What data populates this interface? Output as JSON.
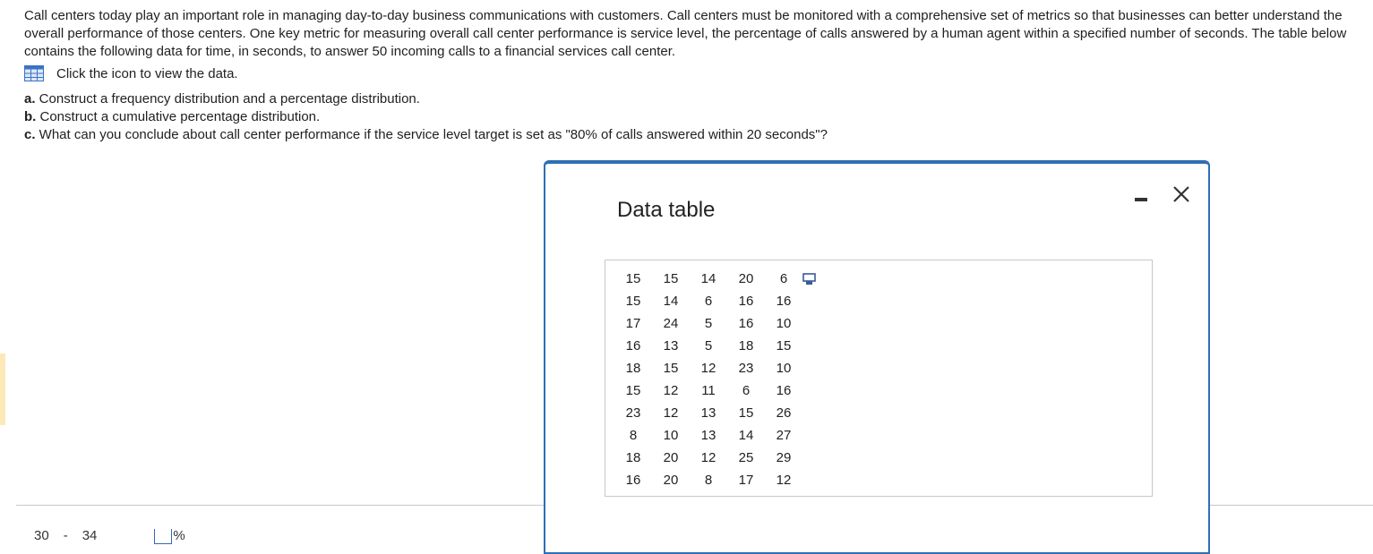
{
  "problem": {
    "intro": "Call centers today play an important role in managing day-to-day business communications with customers. Call centers must be monitored with a comprehensive set of metrics so that businesses can better understand the overall performance of those centers. One key metric for measuring overall call center performance is service level, the percentage of calls answered by a human agent within a specified number of seconds. The table below contains the following data for time, in seconds, to answer 50 incoming calls to a financial services call center.",
    "click_text": "Click the icon to view the data.",
    "parts": [
      {
        "label": "a.",
        "text": " Construct a frequency distribution and a percentage distribution."
      },
      {
        "label": "b.",
        "text": " Construct a cumulative percentage distribution."
      },
      {
        "label": "c.",
        "text": " What can you conclude about call center performance if the service level target is set as \"80% of calls answered within 20 seconds\"?"
      }
    ]
  },
  "answer_row": {
    "low": "30",
    "dash": "-",
    "high": "34",
    "unit": "%"
  },
  "modal": {
    "title": "Data table",
    "rows": [
      [
        "15",
        "15",
        "14",
        "20",
        "6"
      ],
      [
        "15",
        "14",
        "6",
        "16",
        "16"
      ],
      [
        "17",
        "24",
        "5",
        "16",
        "10"
      ],
      [
        "16",
        "13",
        "5",
        "18",
        "15"
      ],
      [
        "18",
        "15",
        "12",
        "23",
        "10"
      ],
      [
        "15",
        "12",
        "11",
        "6",
        "16"
      ],
      [
        "23",
        "12",
        "13",
        "15",
        "26"
      ],
      [
        "8",
        "10",
        "13",
        "14",
        "27"
      ],
      [
        "18",
        "20",
        "12",
        "25",
        "29"
      ],
      [
        "16",
        "20",
        "8",
        "17",
        "12"
      ]
    ]
  },
  "colors": {
    "accent": "#2f6fb5",
    "icon_blue": "#3b73c4"
  },
  "icons": {
    "data": "grid-table-icon",
    "minimize": "minimize-icon",
    "close": "close-icon",
    "copy": "copy-icon"
  }
}
